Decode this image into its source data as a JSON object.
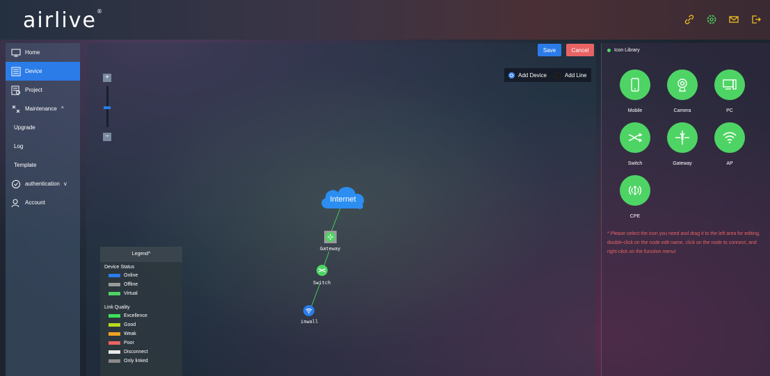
{
  "brand": {
    "logo_text": "airlive",
    "trademark": "®"
  },
  "topbar": {
    "icons": [
      "link-icon",
      "settings-icon",
      "mail-icon",
      "logout-icon"
    ],
    "icon_color": "#f0c020"
  },
  "sidebar": {
    "items": [
      {
        "label": "Home",
        "icon": "monitor-icon"
      },
      {
        "label": "Device",
        "icon": "device-list-icon",
        "active": true
      },
      {
        "label": "Project",
        "icon": "project-icon"
      },
      {
        "label": "Maintenance",
        "icon": "maintenance-icon",
        "expanded": true,
        "chevron": "^"
      },
      {
        "label": "Upgrade",
        "sub": true
      },
      {
        "label": "Log",
        "sub": true
      },
      {
        "label": "Template",
        "sub": true
      },
      {
        "label": "authentication",
        "icon": "check-circle-icon",
        "chevron": "v"
      },
      {
        "label": "Account",
        "icon": "user-icon"
      }
    ]
  },
  "canvas": {
    "save_label": "Save",
    "cancel_label": "Cancel",
    "mode": {
      "add_device": "Add Device",
      "add_line": "Add Line",
      "selected": "add_device"
    },
    "zoom_plus": "+",
    "zoom_minus": "−",
    "zoom_level": 0.5
  },
  "topology": {
    "nodes": [
      {
        "name": "Internet",
        "type": "cloud"
      },
      {
        "name": "Gateway",
        "type": "gateway"
      },
      {
        "name": "Switch",
        "type": "switch"
      },
      {
        "name": "inwall",
        "type": "ap"
      }
    ],
    "link_color": "#3fd15a"
  },
  "legend": {
    "title": "Legend",
    "chevron": "^",
    "device_status_title": "Device Status",
    "device_status": [
      {
        "label": "Online",
        "color": "#2b7ce9"
      },
      {
        "label": "Offline",
        "color": "#9a9a9a"
      },
      {
        "label": "Virtual",
        "color": "#4ed464"
      }
    ],
    "link_quality_title": "Link Quality",
    "link_quality": [
      {
        "label": "Excellence",
        "color": "#3ee05a"
      },
      {
        "label": "Good",
        "color": "#b8d820"
      },
      {
        "label": "Weak",
        "color": "#f0a020"
      },
      {
        "label": "Poor",
        "color": "#e86464"
      },
      {
        "label": "Disconnect",
        "color": "#e8e8e8"
      },
      {
        "label": "Only linked",
        "color": "#8a8a8a"
      }
    ]
  },
  "library": {
    "title": "Icon Library",
    "icons": [
      {
        "label": "Mobile",
        "icon": "mobile-icon"
      },
      {
        "label": "Camera",
        "icon": "camera-icon"
      },
      {
        "label": "PC",
        "icon": "pc-icon"
      },
      {
        "label": "Switch",
        "icon": "switch-icon"
      },
      {
        "label": "Gateway",
        "icon": "gateway-icon"
      },
      {
        "label": "AP",
        "icon": "wifi-icon"
      },
      {
        "label": "CPE",
        "icon": "cpe-icon"
      }
    ],
    "hint": "* Please select the icon you need and drag it to the left area for editing, double-click on the node edit name, click on the node to connect, and right-click on the function menu!",
    "accent": "#4ed464"
  }
}
